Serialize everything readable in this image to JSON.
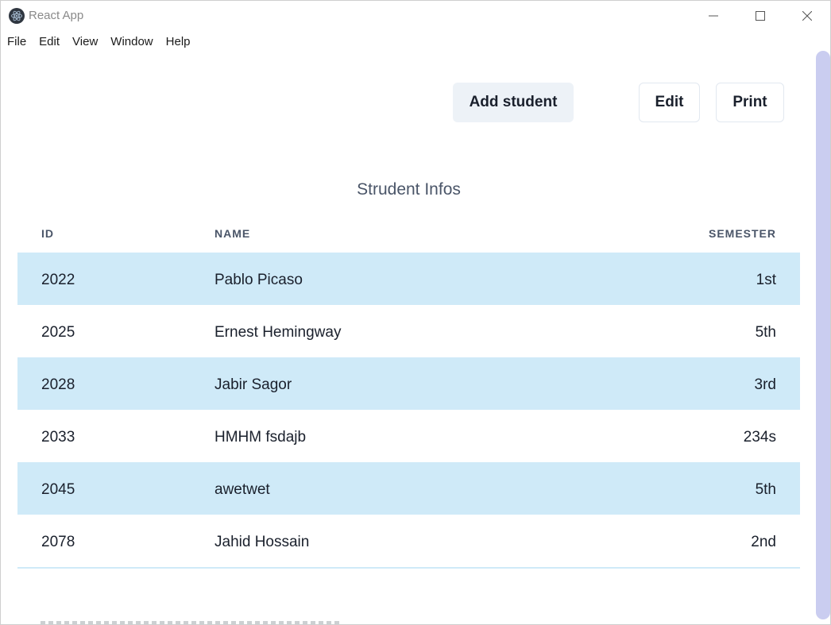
{
  "window": {
    "title": "React App",
    "controls": {
      "minimize": "—",
      "maximize": "☐",
      "close": "✕"
    }
  },
  "menu": {
    "items": [
      "File",
      "Edit",
      "View",
      "Window",
      "Help"
    ]
  },
  "toolbar": {
    "add_label": "Add student",
    "edit_label": "Edit",
    "print_label": "Print"
  },
  "table": {
    "caption": "Strudent Infos",
    "columns": [
      "ID",
      "NAME",
      "SEMESTER"
    ],
    "rows": [
      {
        "id": "2022",
        "name": "Pablo Picaso",
        "semester": "1st"
      },
      {
        "id": "2025",
        "name": "Ernest Hemingway",
        "semester": "5th"
      },
      {
        "id": "2028",
        "name": "Jabir Sagor",
        "semester": "3rd"
      },
      {
        "id": "2033",
        "name": "HMHM fsdajb",
        "semester": "234s"
      },
      {
        "id": "2045",
        "name": "awetwet",
        "semester": "5th"
      },
      {
        "id": "2078",
        "name": "Jahid Hossain",
        "semester": "2nd"
      }
    ]
  },
  "colors": {
    "stripe": "#cfeaf8",
    "add_button_bg": "#edf2f7",
    "scrollbar": "#cacdf0"
  }
}
